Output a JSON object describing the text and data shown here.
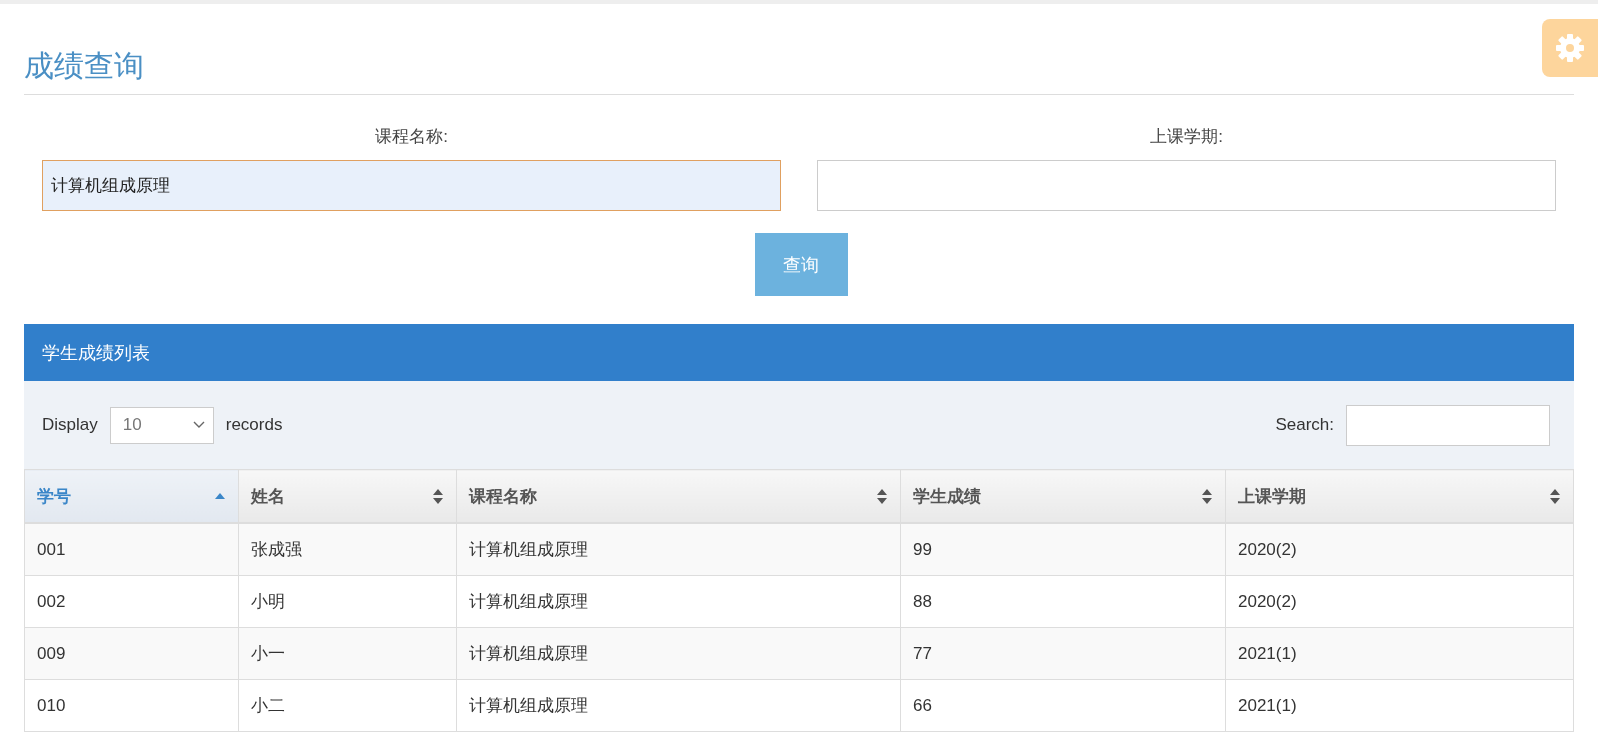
{
  "page_title": "成绩查询",
  "form": {
    "fields": [
      {
        "label": "课程名称:",
        "value": "计算机组成原理",
        "focused": true
      },
      {
        "label": "上课学期:",
        "focused": false
      }
    ],
    "submit_button": "查询"
  },
  "panel": {
    "title": "学生成绩列表",
    "length": {
      "prefix": "Display",
      "value": "10",
      "suffix": "records"
    },
    "search": {
      "label": "Search:"
    },
    "table": {
      "columns": [
        {
          "label": "学号",
          "sorted_ascending": true
        },
        {
          "label": "姓名",
          "sorted_ascending": false
        },
        {
          "label": "课程名称",
          "sorted_ascending": false
        },
        {
          "label": "学生成绩",
          "sorted_ascending": false
        },
        {
          "label": "上课学期",
          "sorted_ascending": false
        }
      ],
      "rows": [
        [
          "001",
          "张成强",
          "计算机组成原理",
          "99",
          "2020(2)"
        ],
        [
          "002",
          "小明",
          "计算机组成原理",
          "88",
          "2020(2)"
        ],
        [
          "009",
          "小一",
          "计算机组成原理",
          "77",
          "2021(1)"
        ],
        [
          "010",
          "小二",
          "计算机组成原理",
          "66",
          "2021(1)"
        ]
      ]
    }
  }
}
